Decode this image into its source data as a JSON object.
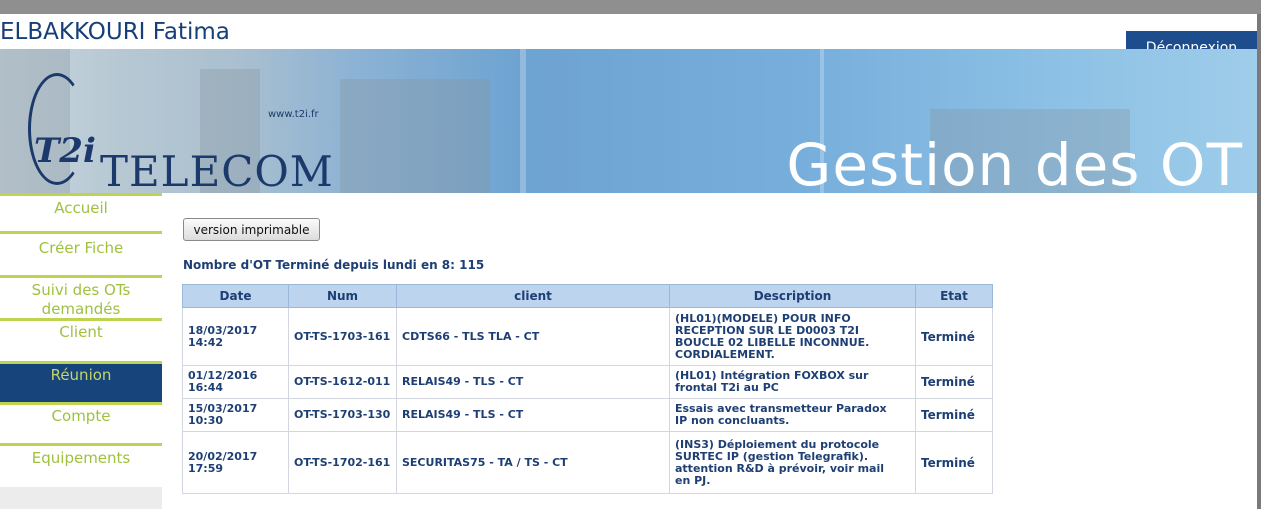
{
  "user": {
    "name": "ELBAKKOURI Fatima"
  },
  "logout_label": "Déconnexion",
  "banner": {
    "logo_mark": "T2i",
    "logo_text": "TELECOM",
    "url": "www.t2i.fr",
    "title": "Gestion des OT"
  },
  "nav": [
    {
      "label": "Accueil",
      "active": false
    },
    {
      "label": "Créer Fiche",
      "active": false
    },
    {
      "label": "Suivi des OTs\ndemandés",
      "active": false
    },
    {
      "label": "Client",
      "active": false
    },
    {
      "label": "Réunion",
      "active": true
    },
    {
      "label": "Compte",
      "active": false
    },
    {
      "label": "Equipements",
      "active": false
    }
  ],
  "print_button": "version imprimable",
  "summary": "Nombre d'OT Terminé depuis lundi en 8: 115",
  "table": {
    "headers": [
      "Date",
      "Num",
      "client",
      "Description",
      "Etat"
    ],
    "rows": [
      {
        "date": "18/03/2017\n14:42",
        "num": "OT-TS-1703-161",
        "client": "CDTS66 - TLS TLA - CT",
        "description": "(HL01)(MODELE) POUR INFO\nRECEPTION SUR LE D0003 T2I\nBOUCLE 02 LIBELLE INCONNUE.\nCORDIALEMENT.",
        "etat": "Terminé"
      },
      {
        "date": "01/12/2016\n16:44",
        "num": "OT-TS-1612-011",
        "client": "RELAIS49 - TLS - CT",
        "description": "(HL01) Intégration FOXBOX sur\nfrontal T2i au PC",
        "etat": "Terminé"
      },
      {
        "date": "15/03/2017\n10:30",
        "num": "OT-TS-1703-130",
        "client": "RELAIS49 - TLS - CT",
        "description": "Essais avec transmetteur Paradox\nIP non concluants.",
        "etat": "Terminé"
      },
      {
        "date": "20/02/2017\n17:59",
        "num": "OT-TS-1702-161",
        "client": "SECURITAS75 - TA / TS - CT",
        "description": "(INS3) Déploiement du protocole\nSURTEC IP (gestion Telegrafik).\nattention R&D à prévoir, voir mail\nen PJ.",
        "etat": "Terminé"
      }
    ]
  }
}
